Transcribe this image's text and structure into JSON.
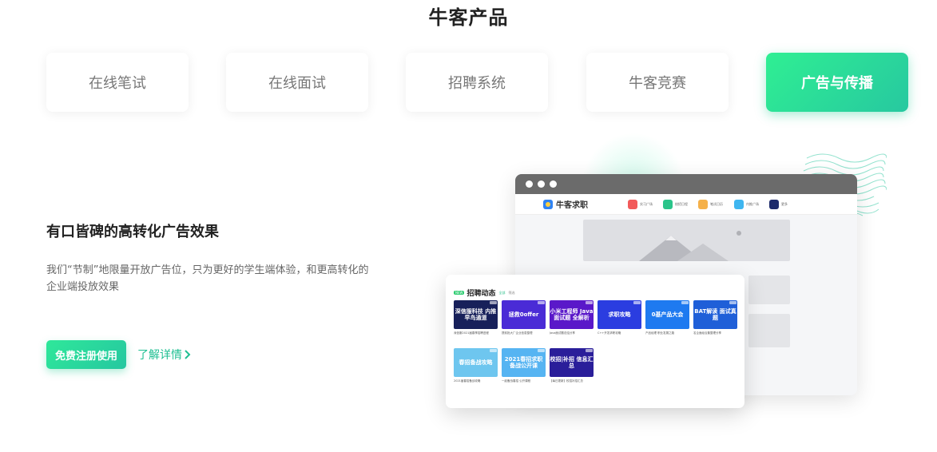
{
  "section_title": "牛客产品",
  "tabs": [
    {
      "label": "在线笔试",
      "active": false
    },
    {
      "label": "在线面试",
      "active": false
    },
    {
      "label": "招聘系统",
      "active": false
    },
    {
      "label": "牛客竞赛",
      "active": false
    },
    {
      "label": "广告与传播",
      "active": true
    }
  ],
  "content": {
    "headline": "有口皆碑的高转化广告效果",
    "description": "我们“节制”地限量开放广告位，只为更好的学生端体验，和更高转化的企业端投放效果",
    "register_label": "免费注册使用",
    "learn_more_label": "了解详情"
  },
  "mockup": {
    "site_name": "牛客求职",
    "nav_items": [
      {
        "label": "实习广场",
        "color": "#f25a5a"
      },
      {
        "label": "校招日程",
        "color": "#2bc48a"
      },
      {
        "label": "笔试日历",
        "color": "#f5b14a"
      },
      {
        "label": "内推广场",
        "color": "#3fb6f0"
      },
      {
        "label": "更多",
        "color": "#1d2b6b"
      }
    ],
    "popup": {
      "badge": "NEW",
      "title": "招聘动态",
      "tab_active": "全部",
      "tab_other": "筛选",
      "cards": [
        {
          "title": "深信服科技 内推早鸟通道",
          "caption": "深信服2021届春季招聘进程",
          "color": "#17205a"
        },
        {
          "title": "拯救0offer",
          "caption": "提前批大厂企业信息整理",
          "color": "#4a2bd6"
        },
        {
          "title": "小米工程师 Java面试题 全解析",
          "caption": "Java面试题总结分享",
          "color": "#5a18c9"
        },
        {
          "title": "求职攻略",
          "caption": "C++开发求职攻略",
          "color": "#2b3de0"
        },
        {
          "title": "0基产品大会",
          "caption": "产品经理 职业发展之路",
          "color": "#1e7af0"
        },
        {
          "title": "BAT解读 面试真题",
          "caption": "名企面经合集整理分享",
          "color": "#1f5fd8"
        },
        {
          "title": "春招备战攻略",
          "caption": "2021届春招备战攻略",
          "color": "#6ec6ef"
        },
        {
          "title": "2021春招求职 备战公开课",
          "caption": "一起备战春招 公开课程",
          "color": "#56b4f2"
        },
        {
          "title": "校招|补招 信息汇总",
          "caption": "【每日更新】校招补招汇总",
          "color": "#2a1e9a"
        }
      ]
    }
  }
}
